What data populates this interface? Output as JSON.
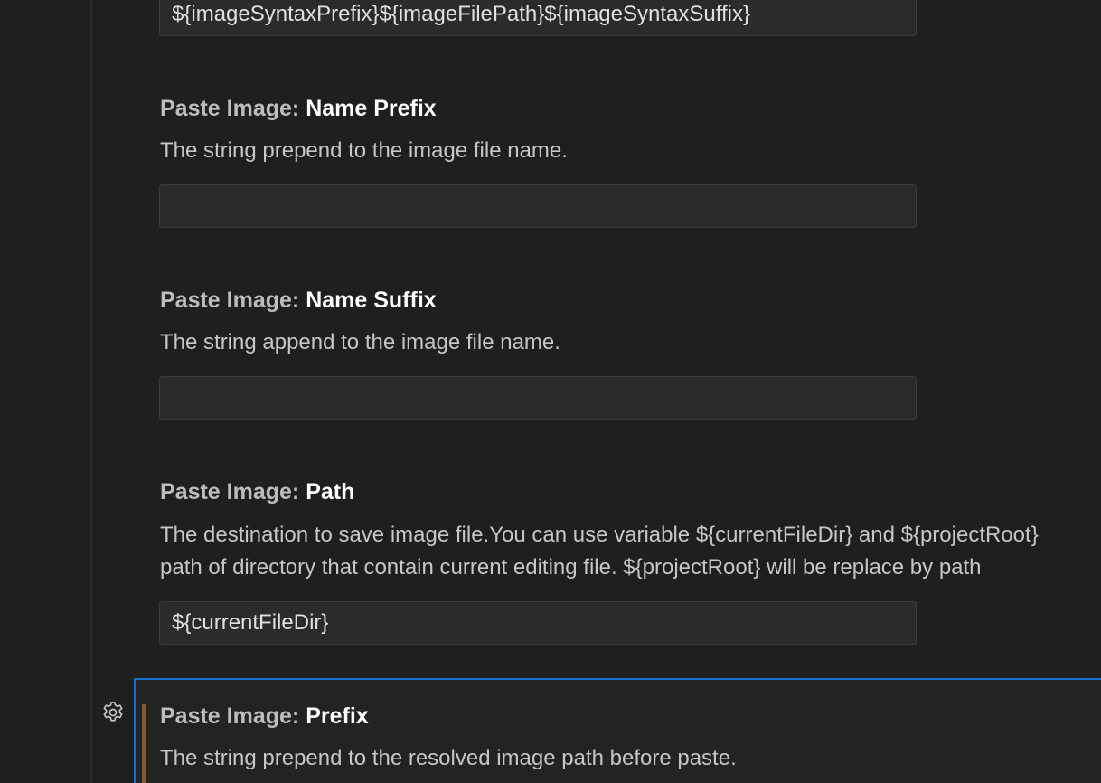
{
  "top_field": {
    "value": "${imageSyntaxPrefix}${imageFilePath}${imageSyntaxSuffix}"
  },
  "settings": [
    {
      "category": "Paste Image: ",
      "name": "Name Prefix",
      "description": "The string prepend to the image file name.",
      "value": ""
    },
    {
      "category": "Paste Image: ",
      "name": "Name Suffix",
      "description": "The string append to the image file name.",
      "value": ""
    },
    {
      "category": "Paste Image: ",
      "name": "Path",
      "description_line1": "The destination to save image file.You can use variable ${currentFileDir} and ${projectRoot}",
      "description_line2": "path of directory that contain current editing file. ${projectRoot} will be replace by path",
      "value": "${currentFileDir}"
    },
    {
      "category": "Paste Image: ",
      "name": "Prefix",
      "description": "The string prepend to the resolved image path before paste."
    }
  ],
  "icons": {
    "gear": "gear-icon"
  },
  "colors": {
    "background": "#1f1f1f",
    "focus_border": "#0e73c9",
    "modified_indicator": "#7b5a2c"
  }
}
